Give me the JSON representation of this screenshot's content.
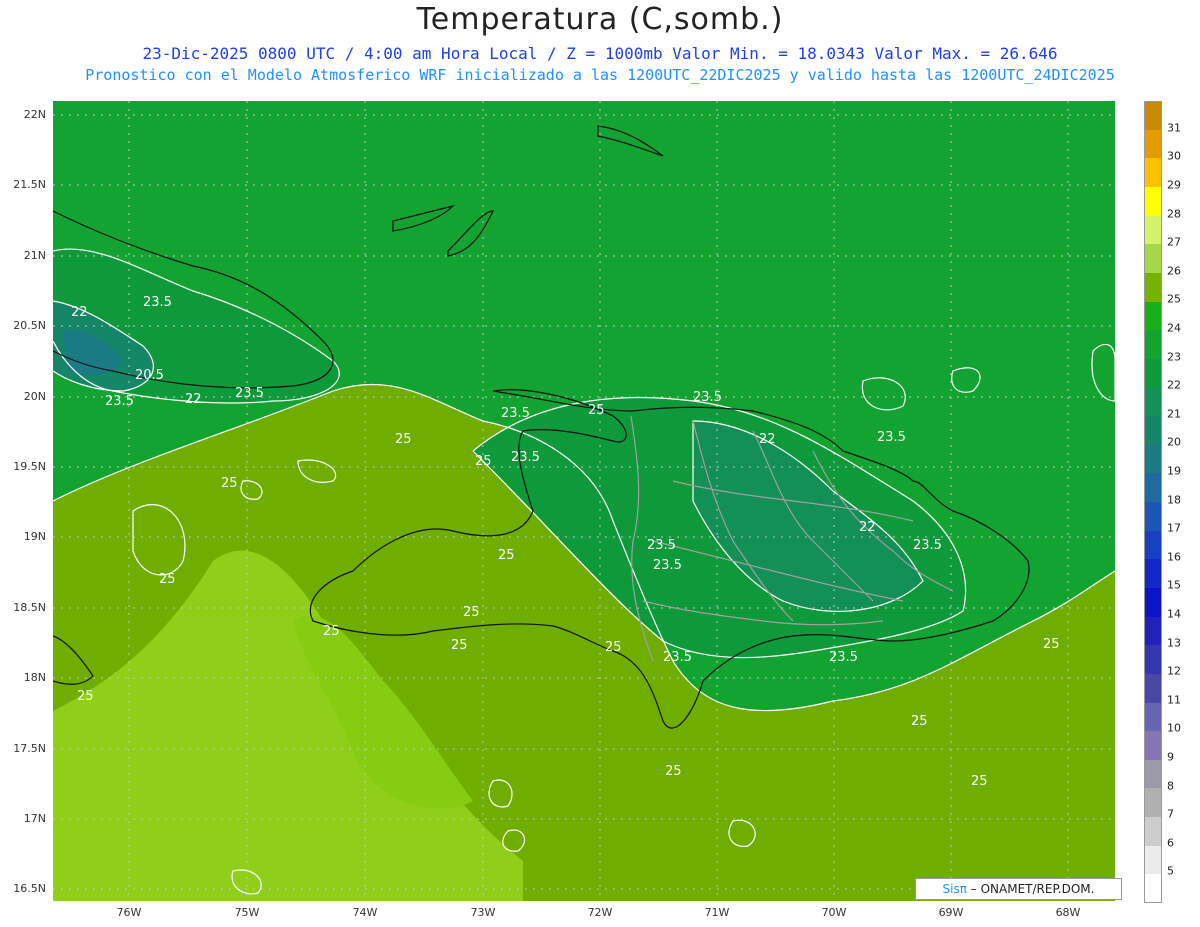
{
  "header": {
    "title": "Temperatura (C,somb.)",
    "line1": "23-Dic-2025  0800 UTC / 4:00 am Hora Local / Z = 1000mb    Valor Min. = 18.0343  Valor Max. = 26.646",
    "line2": "Pronostico con el Modelo Atmosferico WRF inicializado a las 1200UTC_22DIC2025 y valido hasta las  1200UTC_24DIC2025"
  },
  "axes": {
    "lat_labels": [
      "22N",
      "21.5N",
      "21N",
      "20.5N",
      "20N",
      "19.5N",
      "19N",
      "18.5N",
      "18N",
      "17.5N",
      "17N",
      "16.5N"
    ],
    "lon_labels": [
      "76W",
      "75W",
      "74W",
      "73W",
      "72W",
      "71W",
      "70W",
      "69W",
      "68W"
    ]
  },
  "colorbar": {
    "labels": [
      "31",
      "30",
      "29",
      "28",
      "27",
      "26",
      "25",
      "24",
      "23",
      "22",
      "21",
      "20",
      "19",
      "18",
      "17",
      "16",
      "15",
      "14",
      "13",
      "12",
      "11",
      "10",
      "9",
      "8",
      "7",
      "6",
      "5"
    ],
    "colors": [
      "#c88a00",
      "#e39b00",
      "#ffc000",
      "#ffff00",
      "#d2f36a",
      "#a6d94a",
      "#76b300",
      "#18b018",
      "#12a330",
      "#0e9a3a",
      "#129055",
      "#158768",
      "#1a7b85",
      "#1f6aa0",
      "#1d55b5",
      "#1840c0",
      "#1428c8",
      "#0c14c4",
      "#2222b8",
      "#3535b0",
      "#4848a8",
      "#6565b0",
      "#8575b5",
      "#9a9aaa",
      "#b0b0b0",
      "#cdcdcd",
      "#ececec",
      "#ffffff"
    ]
  },
  "contours": [
    {
      "label": "22"
    },
    {
      "label": "23.5"
    },
    {
      "label": "20.5"
    },
    {
      "label": "23.5"
    },
    {
      "label": "22"
    },
    {
      "label": "23.5"
    },
    {
      "label": "25"
    },
    {
      "label": "25"
    },
    {
      "label": "25"
    },
    {
      "label": "23.5"
    },
    {
      "label": "25"
    },
    {
      "label": "23.5"
    },
    {
      "label": "23.5"
    },
    {
      "label": "22"
    },
    {
      "label": "23.5"
    },
    {
      "label": "22"
    },
    {
      "label": "23.5"
    },
    {
      "label": "23.5"
    },
    {
      "label": "23.5"
    },
    {
      "label": "25"
    },
    {
      "label": "25"
    },
    {
      "label": "25"
    },
    {
      "label": "25"
    },
    {
      "label": "25"
    },
    {
      "label": "23.5"
    },
    {
      "label": "23.5"
    },
    {
      "label": "25"
    },
    {
      "label": "25"
    },
    {
      "label": "25"
    },
    {
      "label": "25"
    },
    {
      "label": "25"
    },
    {
      "label": "25"
    }
  ],
  "credit": {
    "brand": "Sisπ",
    "text": " – ONAMET/REP.DOM."
  }
}
